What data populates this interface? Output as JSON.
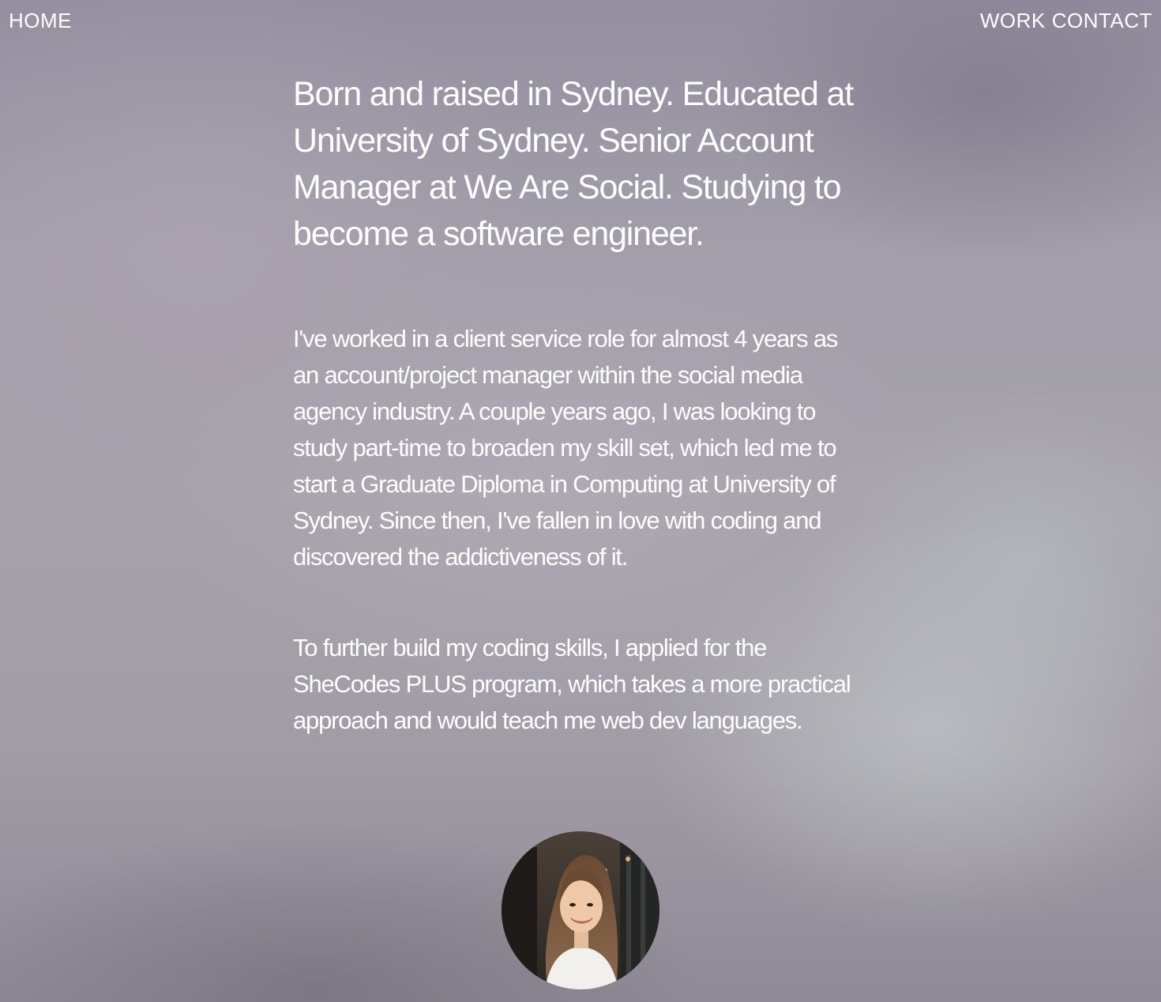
{
  "nav": {
    "home": "HOME",
    "work": "WORK",
    "contact": "CONTACT"
  },
  "about": {
    "headline": "Born and raised in Sydney. Educated at University of Sydney. Senior Account Manager at We Are Social. Studying to become a software engineer.",
    "paragraph1": "I've worked in a client service role for almost 4 years as an account/project manager within the social media agency industry. A couple years ago, I was looking to study part-time to broaden my skill set, which led me to start a Graduate Diploma in Computing at University of Sydney. Since then, I've fallen in love with coding and discovered the addictiveness of it.",
    "paragraph2": "To further build my coding skills, I applied for the SheCodes PLUS program, which takes a more practical approach and would teach me web dev languages."
  },
  "colors": {
    "text": "#ffffff",
    "background": "#a39eaa"
  }
}
